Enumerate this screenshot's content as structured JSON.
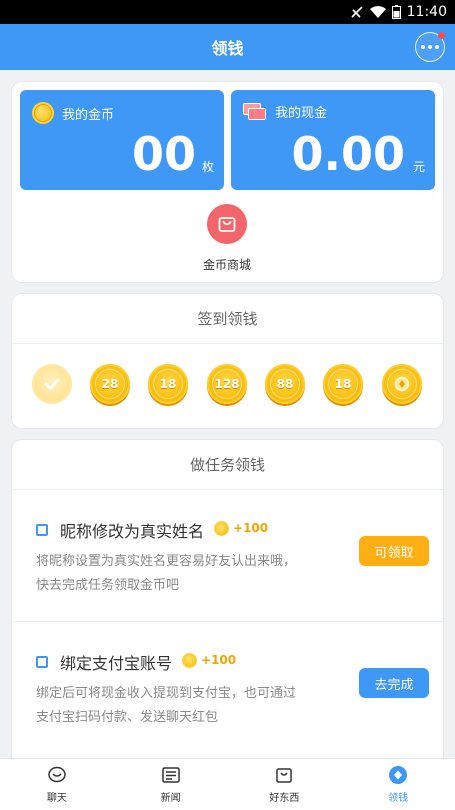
{
  "status_bar": {
    "time": "11:40"
  },
  "header": {
    "title": "领钱"
  },
  "wallet": {
    "coins": {
      "label": "我的金币",
      "amount": "00",
      "unit": "枚"
    },
    "cash": {
      "label": "我的现金",
      "amount": "0.00",
      "unit": "元"
    },
    "mall_label": "金币商城"
  },
  "signin": {
    "title": "签到领钱",
    "days": [
      {
        "value": "",
        "state": "done"
      },
      {
        "value": "28",
        "state": "pending"
      },
      {
        "value": "18",
        "state": "pending"
      },
      {
        "value": "128",
        "state": "pending"
      },
      {
        "value": "88",
        "state": "pending"
      },
      {
        "value": "18",
        "state": "pending"
      },
      {
        "value": "",
        "state": "gift"
      }
    ]
  },
  "tasks": {
    "title": "做任务领钱",
    "items": [
      {
        "title": "昵称修改为真实姓名",
        "reward": "+100",
        "desc1": "将昵称设置为真实姓名更容易好友认出来哦，",
        "desc2": "快去完成任务领取金币吧",
        "button": "可领取"
      },
      {
        "title": "绑定支付宝账号",
        "reward": "+100",
        "desc1": "绑定后可将现金收入提现到支付宝，也可通过",
        "desc2": "支付宝扫码付款、发送聊天红包",
        "button": "去完成"
      }
    ]
  },
  "tabbar": {
    "items": [
      {
        "label": "聊天",
        "icon": "chat-icon"
      },
      {
        "label": "新闻",
        "icon": "news-icon"
      },
      {
        "label": "好东西",
        "icon": "bag-icon"
      },
      {
        "label": "领钱",
        "icon": "money-icon"
      }
    ]
  },
  "colors": {
    "primary": "#3f97f6",
    "claim": "#ffaf14",
    "coin": "#f8b800",
    "mall": "#f2656a"
  }
}
